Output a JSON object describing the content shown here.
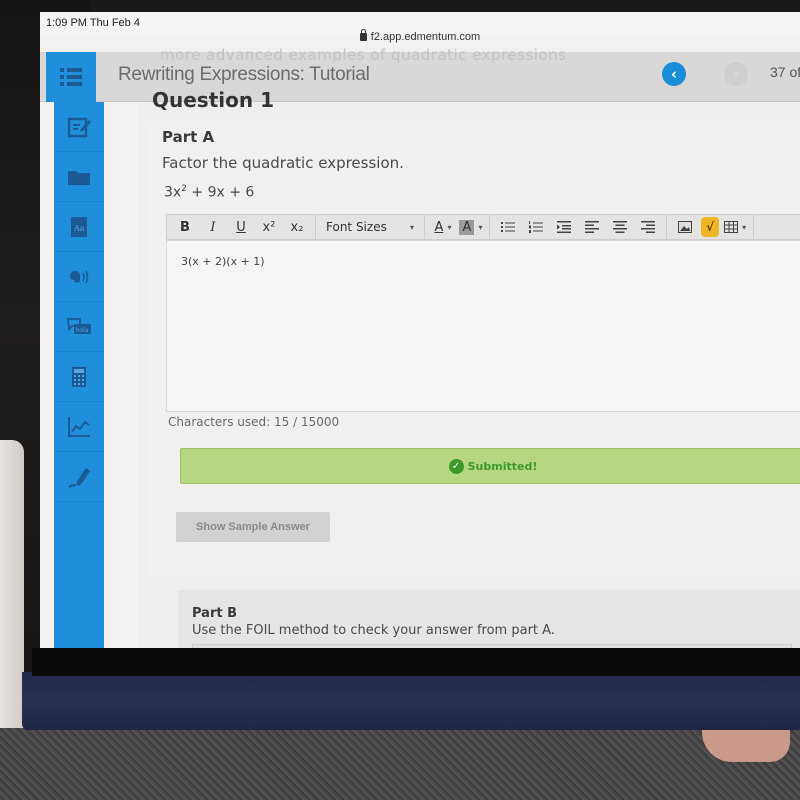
{
  "device": {
    "status_time": "1:09 PM  Thu Feb 4",
    "url": "f2.app.edmentum.com"
  },
  "header": {
    "title": "Rewriting Expressions: Tutorial",
    "ghost_text": "more advanced examples of quadratic expressions",
    "prev_icon": "‹",
    "next_icon": "›",
    "page_count": "37 of"
  },
  "sidebar": {
    "items": [
      {
        "name": "notes",
        "icon": "notepad-edit-icon"
      },
      {
        "name": "files",
        "icon": "folder-icon"
      },
      {
        "name": "dictionary",
        "icon": "dictionary-icon"
      },
      {
        "name": "text-to-speech",
        "icon": "speaker-voice-icon"
      },
      {
        "name": "translate",
        "icon": "hola-chat-icon"
      },
      {
        "name": "calculator",
        "icon": "calculator-icon"
      },
      {
        "name": "graph",
        "icon": "graph-icon"
      },
      {
        "name": "highlighter",
        "icon": "highlighter-icon"
      }
    ]
  },
  "question": {
    "heading": "Question 1"
  },
  "part_a": {
    "title": "Part A",
    "instruction": "Factor the quadratic expression.",
    "expression_lead": "3x",
    "expression_exp": "2",
    "expression_tail": " + 9x + 6",
    "toolbar": {
      "bold": "B",
      "italic": "I",
      "underline": "U",
      "superscript": "x²",
      "subscript": "x₂",
      "font_sizes": "Font Sizes",
      "font_color": "A",
      "highlight": "A",
      "caret": "▾",
      "sqrt": "√"
    },
    "answer": "3(x + 2)(x + 1)",
    "characters_used": "Characters used: 15 / 15000",
    "status": "Submitted!",
    "status_color": "#3c9a2b",
    "show_sample_label": "Show Sample Answer"
  },
  "part_b": {
    "title": "Part B",
    "instruction": "Use the FOIL method to check your answer from part A."
  }
}
